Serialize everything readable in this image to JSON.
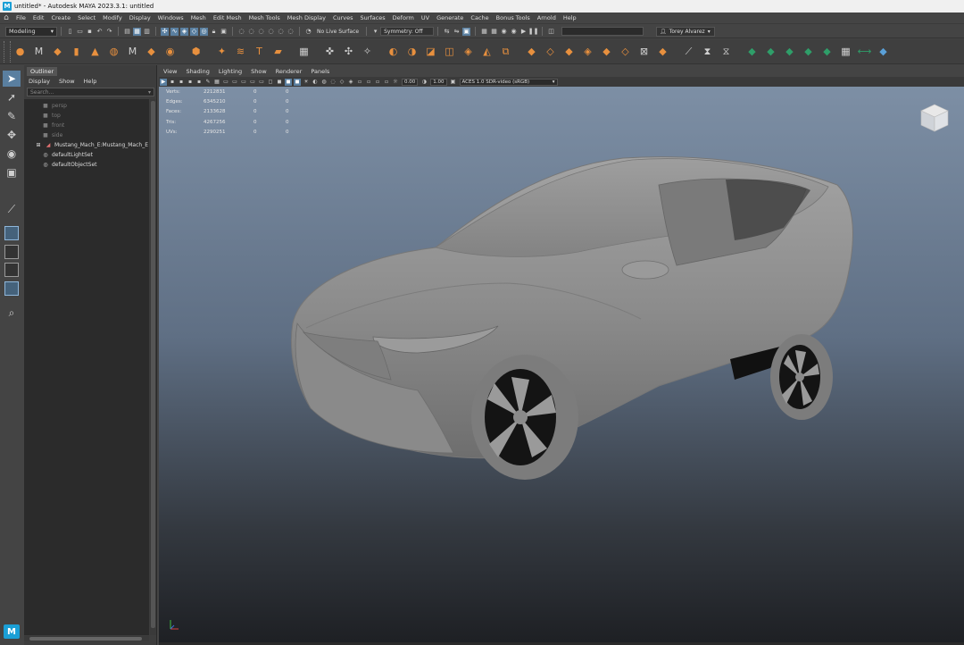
{
  "window": {
    "title": "untitled* - Autodesk MAYA 2023.3.1: untitled",
    "app_icon": "M"
  },
  "menubar": [
    "File",
    "Edit",
    "Create",
    "Select",
    "Modify",
    "Display",
    "Windows",
    "Mesh",
    "Edit Mesh",
    "Mesh Tools",
    "Mesh Display",
    "Curves",
    "Surfaces",
    "Deform",
    "UV",
    "Generate",
    "Cache",
    "Bonus Tools",
    "Arnold",
    "Help"
  ],
  "statusline": {
    "menuset": "Modeling",
    "live_surface": "No Live Surface",
    "symmetry": "Symmetry: Off",
    "user": "Torey Alvarez"
  },
  "outliner": {
    "tab": "Outliner",
    "menu": [
      "Display",
      "Show",
      "Help"
    ],
    "search_placeholder": "Search...",
    "items": [
      {
        "label": "persp",
        "icon": "camera-icon"
      },
      {
        "label": "top",
        "icon": "camera-icon"
      },
      {
        "label": "front",
        "icon": "camera-icon"
      },
      {
        "label": "side",
        "icon": "camera-icon"
      },
      {
        "label": "Mustang_Mach_E:Mustang_Mach_E",
        "icon": "mesh-icon"
      },
      {
        "label": "defaultLightSet",
        "icon": "set-icon"
      },
      {
        "label": "defaultObjectSet",
        "icon": "set-icon"
      }
    ]
  },
  "viewport": {
    "menu": [
      "View",
      "Shading",
      "Lighting",
      "Show",
      "Renderer",
      "Panels"
    ],
    "exposure": "0.00",
    "gamma": "1.00",
    "colorspace": "ACES 1.0 SDR-video (sRGB)",
    "hud": [
      {
        "label": "Verts:",
        "v1": "2212831",
        "v2": "0",
        "v3": "0"
      },
      {
        "label": "Edges:",
        "v1": "6345210",
        "v2": "0",
        "v3": "0"
      },
      {
        "label": "Faces:",
        "v1": "2133628",
        "v2": "0",
        "v3": "0"
      },
      {
        "label": "Tris:",
        "v1": "4267256",
        "v2": "0",
        "v3": "0"
      },
      {
        "label": "UVs:",
        "v1": "2290251",
        "v2": "0",
        "v3": "0"
      }
    ]
  },
  "colors": {
    "accent": "#5a7fa0",
    "shelf_orange": "#e8903e",
    "maya_blue": "#1a9fd6"
  }
}
